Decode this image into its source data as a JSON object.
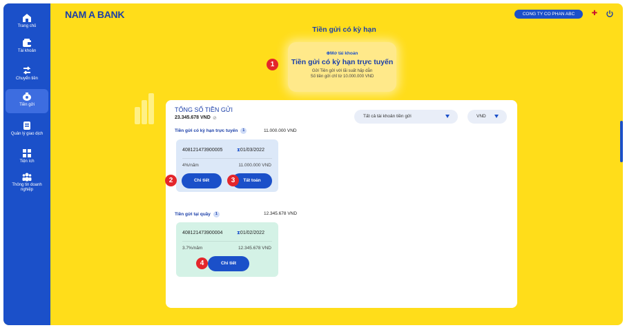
{
  "sidebar": {
    "items": [
      {
        "label": "Trang chủ",
        "icon": "home-icon"
      },
      {
        "label": "Tài khoản",
        "icon": "wallet-icon"
      },
      {
        "label": "Chuyển tiền",
        "icon": "transfer-icon"
      },
      {
        "label": "Tiền gửi",
        "icon": "piggy-bank-icon"
      },
      {
        "label": "Quản lý giao dịch",
        "icon": "document-icon"
      },
      {
        "label": "Tiện ích",
        "icon": "grid-icon"
      },
      {
        "label": "Thông tin doanh nghiệp",
        "icon": "users-icon"
      }
    ],
    "active_index": 3
  },
  "header": {
    "logo": "NAM A BANK",
    "company": "CONG TY CO PHAN ABC",
    "flag_icon": "uk-flag-icon",
    "power_icon": "power-icon"
  },
  "page_title": "Tiền gửi có kỳ hạn",
  "promo": {
    "open_label": "Mở tài khoản",
    "title": "Tiền gửi có kỳ hạn trực tuyến",
    "desc1": "Gửi Tiền gửi với lãi suất hấp dẫn",
    "desc2": "Số tiền gửi chỉ từ 10.000.000 VND"
  },
  "badges": [
    "1",
    "2",
    "3",
    "4"
  ],
  "summary": {
    "title": "TỔNG SỐ TIỀN GỬI",
    "amount": "23.345.678 VND",
    "account_filter": "Tất cả tài khoản tiền gửi",
    "currency_filter": "VND"
  },
  "online_section": {
    "title": "Tiền gửi có kỳ hạn trực tuyến",
    "count": "1",
    "amount": "11.000.000 VND",
    "deposit": {
      "account": "408121473900005",
      "date": "01/03/2022",
      "rate": "4%/năm",
      "amount": "11.000.000 VND"
    },
    "detail_button": "Chi tiết",
    "settle_button": "Tất toán"
  },
  "counter_section": {
    "title": "Tiền gửi tại quầy",
    "count": "1",
    "amount": "12.345.678 VND",
    "deposit": {
      "account": "408121473900004",
      "date": "01/02/2022",
      "rate": "3.7%/năm",
      "amount": "12.345.678 VND"
    },
    "detail_button": "Chi tiết"
  },
  "colors": {
    "background": "#ffdd1a",
    "sidebar": "#1b50c9",
    "primary": "#1b50c9",
    "badge": "#e4262b",
    "online_card": "#dce8f8",
    "counter_card": "#d4f2e6"
  }
}
